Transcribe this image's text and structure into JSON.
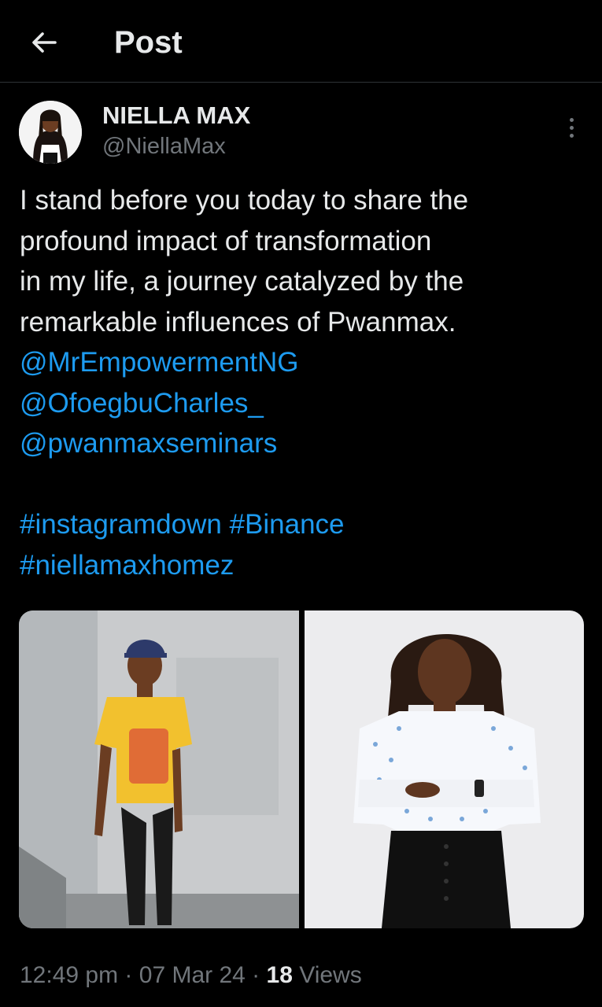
{
  "header": {
    "title": "Post",
    "back_icon": "arrow-left-icon"
  },
  "author": {
    "name": "NIELLA MAX",
    "handle": "@NiellaMax"
  },
  "tweet": {
    "text_lines": [
      "I stand before you today to share the",
      "profound impact of transformation",
      "in my life, a journey catalyzed by the",
      "remarkable influences of Pwanmax."
    ],
    "mentions": [
      "@MrEmpowermentNG",
      "@OfoegbuCharles_",
      "@pwanmaxseminars"
    ],
    "hashtags": {
      "line1_a": "#instagramdown",
      "line1_b": "#Binance",
      "line2": "#niellamaxhomez"
    }
  },
  "meta": {
    "time": "12:49 pm",
    "sep1": " · ",
    "date": "07 Mar 24",
    "sep2": " · ",
    "views_count": "18",
    "views_label": " Views"
  },
  "colors": {
    "background": "#000000",
    "text": "#e7e9ea",
    "secondary": "#71767b",
    "link": "#1d9bf0",
    "divider": "#2f3336"
  }
}
